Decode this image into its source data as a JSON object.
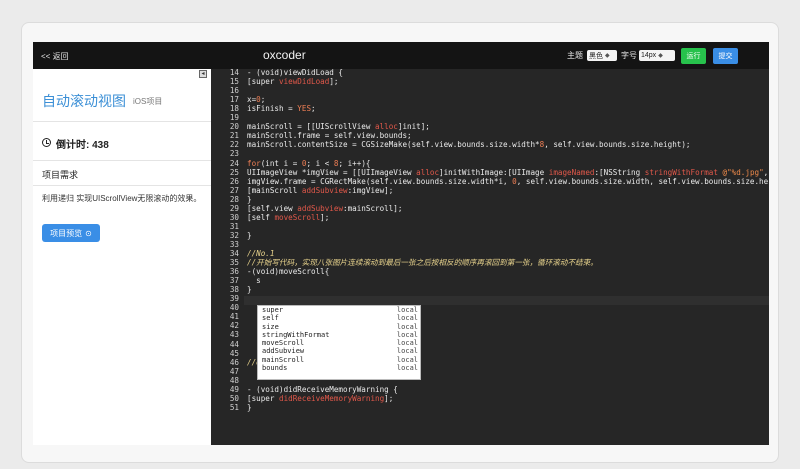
{
  "topbar": {
    "back_label": "<< 返回",
    "title": "oxcoder",
    "theme_label": "主题",
    "theme_value": "黑色",
    "font_label": "字号",
    "font_value": "14px",
    "run_label": "运行",
    "submit_label": "提交",
    "run_color": "#27c24c",
    "submit_color": "#3a8ee6"
  },
  "sidebar": {
    "collapse_icon": "◂",
    "project_title": "自动滚动视图",
    "project_tag": "iOS项目",
    "timer": "倒计时: 438",
    "requirement_heading": "项目需求",
    "requirement_text": "利用递归 实现UIScrollView无限滚动的效果。",
    "preview_label": "项目预览",
    "preview_icon": "⊙"
  },
  "editor": {
    "lines": [
      {
        "n": "14",
        "html": "- (void)viewDidLoad {"
      },
      {
        "n": "15",
        "html": "[super <span class=\"fn\">viewDidLoad</span>];"
      },
      {
        "n": "16",
        "html": ""
      },
      {
        "n": "17",
        "html": "x=<span class=\"nm\">0</span>;"
      },
      {
        "n": "18",
        "html": "isFinish = <span class=\"kw\">YES</span>;"
      },
      {
        "n": "19",
        "html": ""
      },
      {
        "n": "20",
        "html": "mainScroll = [[UIScrollView <span class=\"fn\">alloc</span>]init];"
      },
      {
        "n": "21",
        "html": "mainScroll.frame = self.view.bounds;"
      },
      {
        "n": "22",
        "html": "mainScroll.contentSize = CGSizeMake(self.view.bounds.size.width*<span class=\"nm\">8</span>, self.view.bounds.size.height);"
      },
      {
        "n": "23",
        "html": ""
      },
      {
        "n": "24",
        "html": "<span class=\"kw\">for</span>(int i = <span class=\"nm\">0</span>; i &lt; <span class=\"nm\">8</span>; i++){"
      },
      {
        "n": "25",
        "html": "UIImageView *imgView = [[UIImageView <span class=\"fn\">alloc</span>]initWithImage:[UIImage <span class=\"fn\">imageNamed</span>:[NSString <span class=\"fn\">stringWithFormat</span> <span class=\"st\">@\"%d.jpg\"</span>,"
      },
      {
        "n": "26",
        "html": "imgView.frame = CGRectMake(self.view.bounds.size.width*i, <span class=\"nm\">0</span>, self.view.bounds.size.width, self.view.bounds.size.he"
      },
      {
        "n": "27",
        "html": "[mainScroll <span class=\"fn\">addSubview</span>:imgView];"
      },
      {
        "n": "28",
        "html": "}"
      },
      {
        "n": "29",
        "html": "[self.view <span class=\"fn\">addSubview</span>:mainScroll];"
      },
      {
        "n": "30",
        "html": "[self <span class=\"fn\">moveScroll</span>];"
      },
      {
        "n": "31",
        "html": ""
      },
      {
        "n": "32",
        "html": "}"
      },
      {
        "n": "33",
        "html": ""
      },
      {
        "n": "34",
        "html": "<span class=\"cm\">//No.1</span>"
      },
      {
        "n": "35",
        "html": "<span class=\"cm\">//开始写代码，实现八张图片连续滚动到最后一张之后按相反的顺序再滚回到第一张，循环滚动不结束。</span>"
      },
      {
        "n": "36",
        "html": "-(void)moveScroll{"
      },
      {
        "n": "37",
        "html": "  s"
      },
      {
        "n": "38",
        "html": "}"
      },
      {
        "n": "39",
        "html": ""
      },
      {
        "n": "40",
        "html": ""
      },
      {
        "n": "41",
        "html": ""
      },
      {
        "n": "42",
        "html": ""
      },
      {
        "n": "43",
        "html": ""
      },
      {
        "n": "44",
        "html": ""
      },
      {
        "n": "45",
        "html": ""
      },
      {
        "n": "46",
        "html": "<span class=\"cm\">//end_code</span>"
      },
      {
        "n": "47",
        "html": ""
      },
      {
        "n": "48",
        "html": ""
      },
      {
        "n": "49",
        "html": "- (void)didReceiveMemoryWarning {"
      },
      {
        "n": "50",
        "html": "[super <span class=\"fn\">didReceiveMemoryWarning</span>];"
      },
      {
        "n": "51",
        "html": "}"
      }
    ],
    "autocomplete": [
      {
        "name": "super",
        "kind": "local"
      },
      {
        "name": "self",
        "kind": "local"
      },
      {
        "name": "size",
        "kind": "local"
      },
      {
        "name": "stringWithFormat",
        "kind": "local"
      },
      {
        "name": "moveScroll",
        "kind": "local"
      },
      {
        "name": "addSubview",
        "kind": "local"
      },
      {
        "name": "mainScroll",
        "kind": "local"
      },
      {
        "name": "bounds",
        "kind": "local"
      }
    ]
  }
}
